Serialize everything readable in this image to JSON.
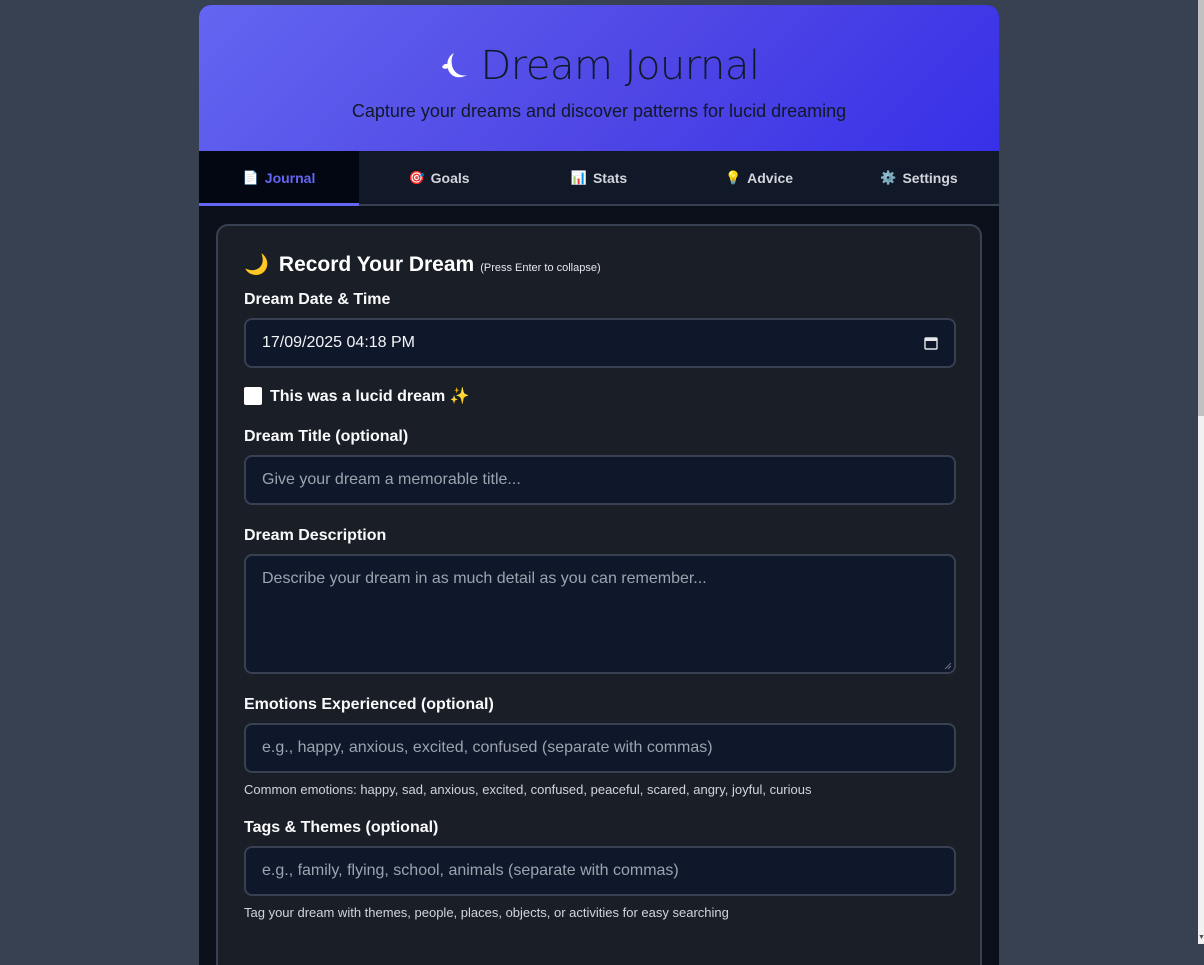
{
  "header": {
    "title": "Dream Journal",
    "subtitle": "Capture your dreams and discover patterns for lucid dreaming"
  },
  "tabs": [
    {
      "icon": "📄",
      "label": "Journal",
      "active": true
    },
    {
      "icon": "🎯",
      "label": "Goals",
      "active": false
    },
    {
      "icon": "📊",
      "label": "Stats",
      "active": false
    },
    {
      "icon": "💡",
      "label": "Advice",
      "active": false
    },
    {
      "icon": "⚙️",
      "label": "Settings",
      "active": false
    }
  ],
  "form": {
    "emoji": "🌙",
    "title": "Record Your Dream",
    "hint": "(Press Enter to collapse)",
    "date_label": "Dream Date & Time",
    "date_value": "17/09/2025 04:18 PM",
    "lucid_label": "This was a lucid dream ✨",
    "lucid_checked": false,
    "title_label": "Dream Title (optional)",
    "title_placeholder": "Give your dream a memorable title...",
    "description_label": "Dream Description",
    "description_placeholder": "Describe your dream in as much detail as you can remember...",
    "emotions_label": "Emotions Experienced (optional)",
    "emotions_placeholder": "e.g., happy, anxious, excited, confused (separate with commas)",
    "emotions_help": "Common emotions: happy, sad, anxious, excited, confused, peaceful, scared, angry, joyful, curious",
    "tags_label": "Tags & Themes (optional)",
    "tags_placeholder": "e.g., family, flying, school, animals (separate with commas)",
    "tags_help": "Tag your dream with themes, people, places, objects, or activities for easy searching"
  },
  "colors": {
    "accent": "#6366f1",
    "page_bg": "#374151",
    "card_bg": "#1a1e26"
  }
}
